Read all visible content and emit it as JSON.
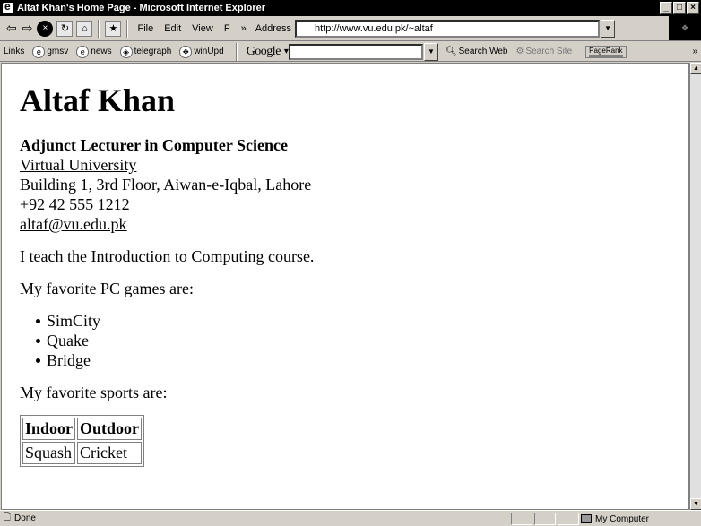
{
  "window": {
    "title": "Altaf Khan's Home Page - Microsoft Internet Explorer",
    "buttons": [
      "_",
      "□",
      "×"
    ]
  },
  "toolbar": {
    "back_glyph": "⇦",
    "forward_glyph": "⇨",
    "stop_glyph": "×",
    "menus": [
      "File",
      "Edit",
      "View",
      "F"
    ],
    "chevron": "»",
    "address_label": "Address",
    "address_value": "http://www.vu.edu.pk/~altaf"
  },
  "links_bar": {
    "label": "Links",
    "items": [
      "gmsv",
      "news",
      "telegraph",
      "winUpd"
    ],
    "google_logo": "Google",
    "search_web": "Search Web",
    "search_site": "Search Site",
    "pagerank": "PageRank",
    "chevron": "»"
  },
  "page": {
    "heading": "Altaf Khan",
    "position": "Adjunct Lecturer in Computer Science",
    "university": "Virtual University",
    "address": "Building 1, 3rd Floor, Aiwan-e-Iqbal, Lahore",
    "phone": "+92 42 555 1212",
    "email": "altaf@vu.edu.pk",
    "teach_prefix": "I teach the ",
    "teach_link": "Introduction to Computing",
    "teach_suffix": " course.",
    "games_intro": "My favorite PC games are:",
    "games": [
      "SimCity",
      "Quake",
      "Bridge"
    ],
    "sports_intro": "My favorite sports are:",
    "sports_headers": [
      "Indoor",
      "Outdoor"
    ],
    "sports_row": [
      "Squash",
      "Cricket"
    ]
  },
  "status": {
    "text": "Done",
    "zone": "My Computer"
  }
}
